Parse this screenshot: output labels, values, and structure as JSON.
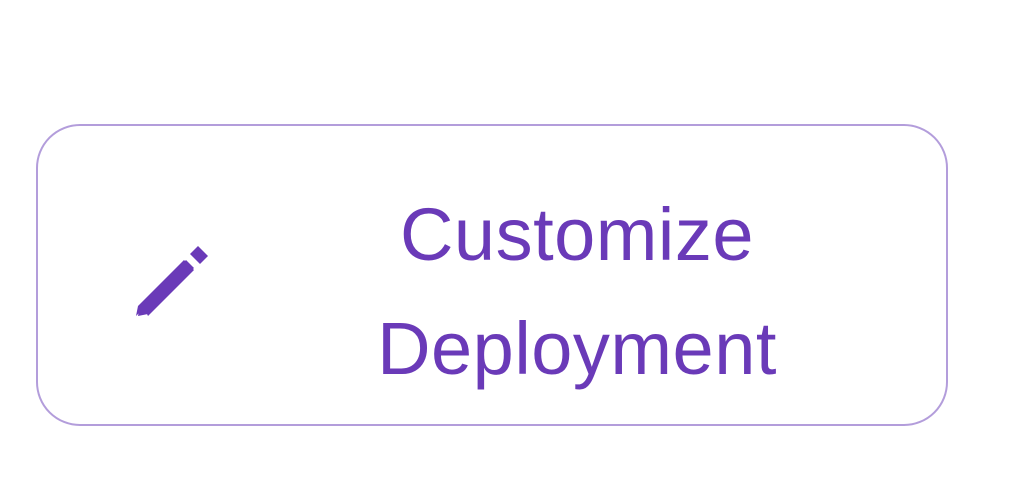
{
  "button": {
    "line1": "Customize",
    "line2": "Deployment",
    "icon": "pencil-icon",
    "text_color": "#6a3ab8",
    "border_color": "#b39ddb"
  }
}
